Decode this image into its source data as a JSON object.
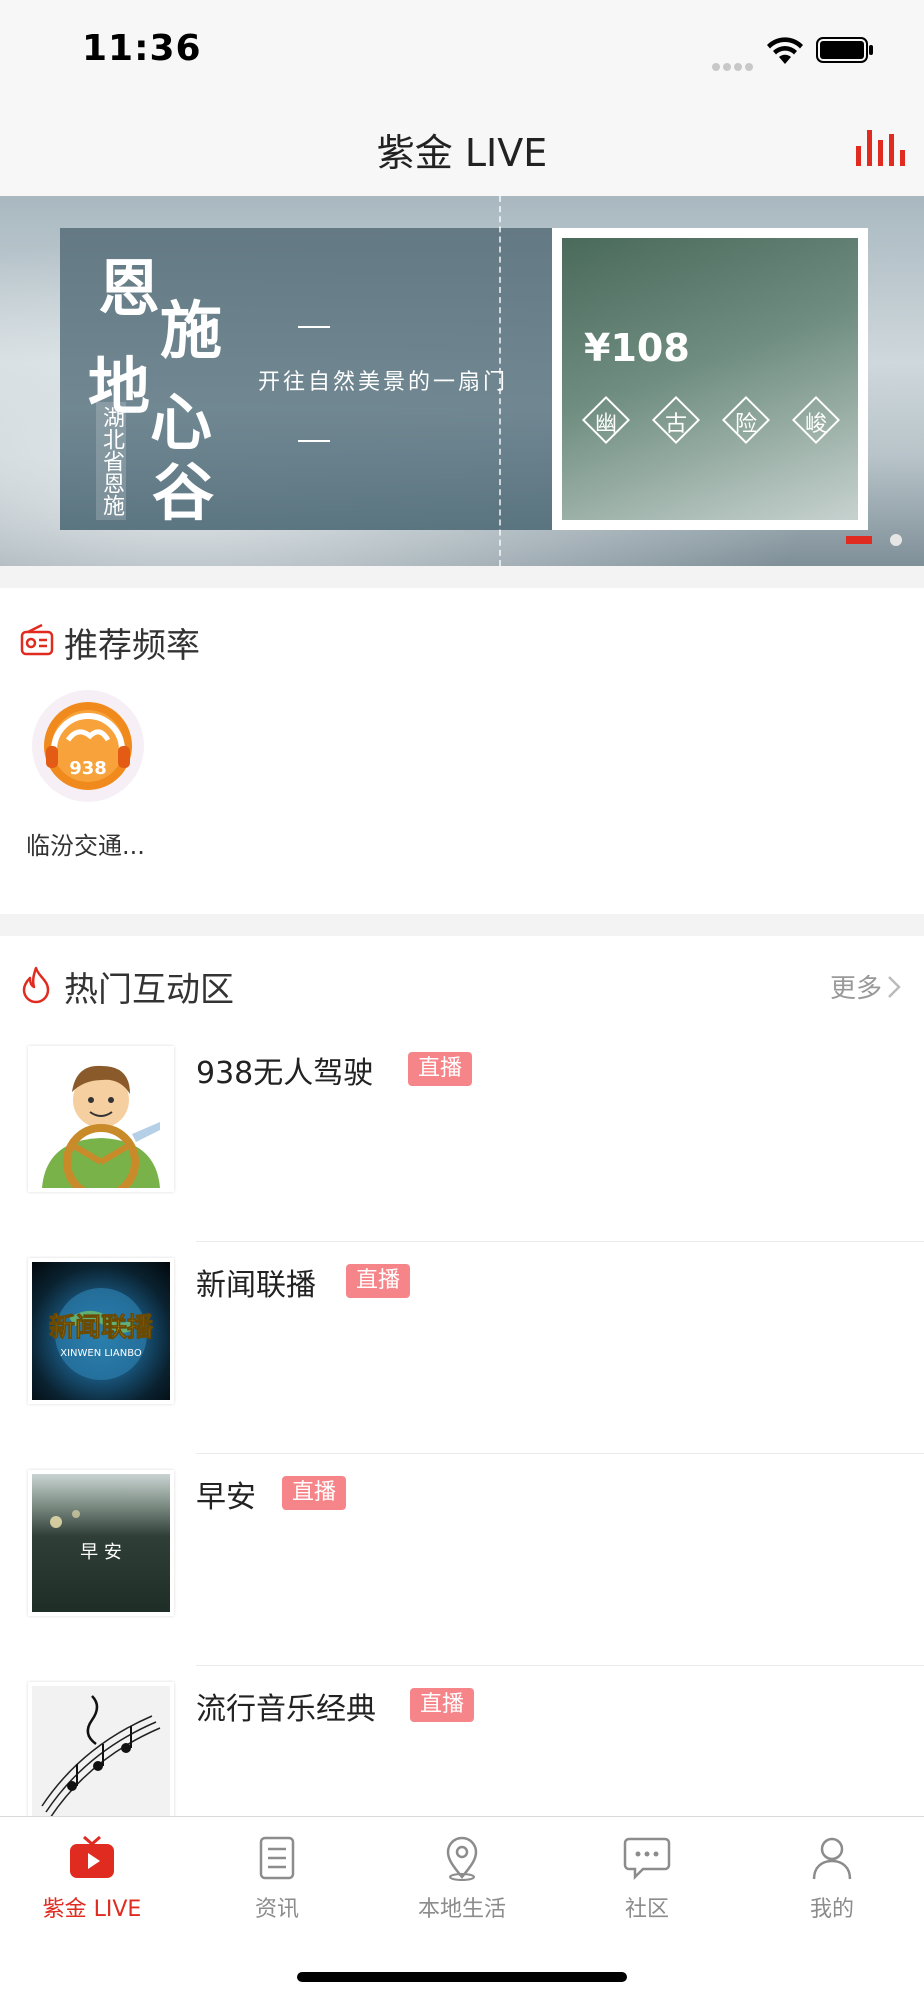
{
  "status_bar": {
    "time": "11:36"
  },
  "nav": {
    "title": "紫金 LIVE",
    "eq_icon": "equalizer-icon"
  },
  "banner": {
    "calligraphy": [
      "恩",
      "施",
      "地",
      "心",
      "谷"
    ],
    "subtitle": "湖北省恩施",
    "slogan": "开往自然美景的一扇门",
    "price": "¥108",
    "tags": [
      "幽",
      "古",
      "险",
      "峻"
    ],
    "page_count": 2,
    "active_page": 1
  },
  "recommended": {
    "title": "推荐频率",
    "stations": [
      {
        "name": "临汾交通...",
        "logo_text": "938"
      }
    ]
  },
  "hot": {
    "title": "热门互动区",
    "more": "更多",
    "items": [
      {
        "title": "938无人驾驶",
        "badge": "直播"
      },
      {
        "title": "新闻联播",
        "badge": "直播",
        "thumb_text": "新闻联播",
        "thumb_sub": "XINWEN LIANBO"
      },
      {
        "title": "早安",
        "badge": "直播",
        "thumb_text": "早 安"
      },
      {
        "title": "流行音乐经典",
        "badge": "直播"
      }
    ]
  },
  "tabs": [
    {
      "label": "紫金 LIVE",
      "icon": "tv-icon",
      "active": true
    },
    {
      "label": "资讯",
      "icon": "news-icon",
      "active": false
    },
    {
      "label": "本地生活",
      "icon": "location-icon",
      "active": false
    },
    {
      "label": "社区",
      "icon": "chat-icon",
      "active": false
    },
    {
      "label": "我的",
      "icon": "profile-icon",
      "active": false
    }
  ],
  "colors": {
    "accent": "#e02b20",
    "badge": "#f6858a"
  }
}
